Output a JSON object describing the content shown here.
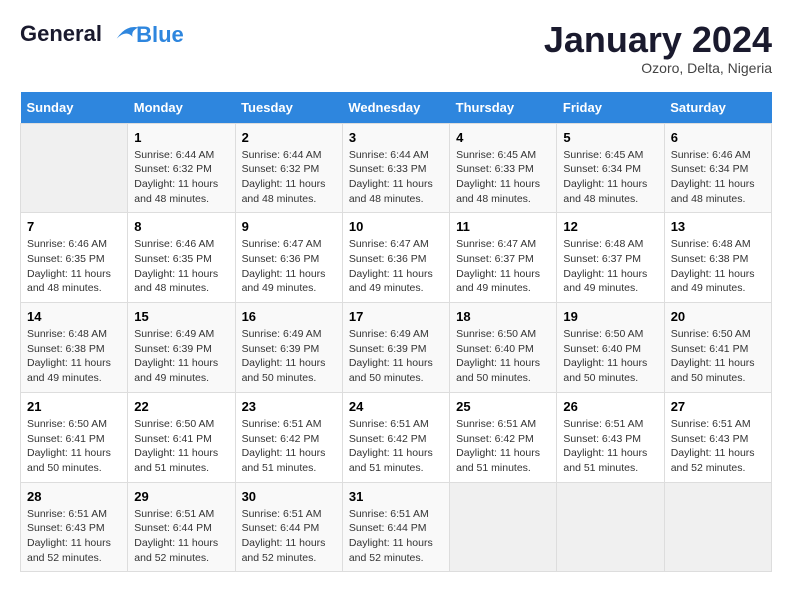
{
  "logo": {
    "line1": "General",
    "line2": "Blue"
  },
  "title": "January 2024",
  "location": "Ozoro, Delta, Nigeria",
  "days_of_week": [
    "Sunday",
    "Monday",
    "Tuesday",
    "Wednesday",
    "Thursday",
    "Friday",
    "Saturday"
  ],
  "weeks": [
    [
      {
        "day": "",
        "info": ""
      },
      {
        "day": "1",
        "info": "Sunrise: 6:44 AM\nSunset: 6:32 PM\nDaylight: 11 hours\nand 48 minutes."
      },
      {
        "day": "2",
        "info": "Sunrise: 6:44 AM\nSunset: 6:32 PM\nDaylight: 11 hours\nand 48 minutes."
      },
      {
        "day": "3",
        "info": "Sunrise: 6:44 AM\nSunset: 6:33 PM\nDaylight: 11 hours\nand 48 minutes."
      },
      {
        "day": "4",
        "info": "Sunrise: 6:45 AM\nSunset: 6:33 PM\nDaylight: 11 hours\nand 48 minutes."
      },
      {
        "day": "5",
        "info": "Sunrise: 6:45 AM\nSunset: 6:34 PM\nDaylight: 11 hours\nand 48 minutes."
      },
      {
        "day": "6",
        "info": "Sunrise: 6:46 AM\nSunset: 6:34 PM\nDaylight: 11 hours\nand 48 minutes."
      }
    ],
    [
      {
        "day": "7",
        "info": "Sunrise: 6:46 AM\nSunset: 6:35 PM\nDaylight: 11 hours\nand 48 minutes."
      },
      {
        "day": "8",
        "info": "Sunrise: 6:46 AM\nSunset: 6:35 PM\nDaylight: 11 hours\nand 48 minutes."
      },
      {
        "day": "9",
        "info": "Sunrise: 6:47 AM\nSunset: 6:36 PM\nDaylight: 11 hours\nand 49 minutes."
      },
      {
        "day": "10",
        "info": "Sunrise: 6:47 AM\nSunset: 6:36 PM\nDaylight: 11 hours\nand 49 minutes."
      },
      {
        "day": "11",
        "info": "Sunrise: 6:47 AM\nSunset: 6:37 PM\nDaylight: 11 hours\nand 49 minutes."
      },
      {
        "day": "12",
        "info": "Sunrise: 6:48 AM\nSunset: 6:37 PM\nDaylight: 11 hours\nand 49 minutes."
      },
      {
        "day": "13",
        "info": "Sunrise: 6:48 AM\nSunset: 6:38 PM\nDaylight: 11 hours\nand 49 minutes."
      }
    ],
    [
      {
        "day": "14",
        "info": "Sunrise: 6:48 AM\nSunset: 6:38 PM\nDaylight: 11 hours\nand 49 minutes."
      },
      {
        "day": "15",
        "info": "Sunrise: 6:49 AM\nSunset: 6:39 PM\nDaylight: 11 hours\nand 49 minutes."
      },
      {
        "day": "16",
        "info": "Sunrise: 6:49 AM\nSunset: 6:39 PM\nDaylight: 11 hours\nand 50 minutes."
      },
      {
        "day": "17",
        "info": "Sunrise: 6:49 AM\nSunset: 6:39 PM\nDaylight: 11 hours\nand 50 minutes."
      },
      {
        "day": "18",
        "info": "Sunrise: 6:50 AM\nSunset: 6:40 PM\nDaylight: 11 hours\nand 50 minutes."
      },
      {
        "day": "19",
        "info": "Sunrise: 6:50 AM\nSunset: 6:40 PM\nDaylight: 11 hours\nand 50 minutes."
      },
      {
        "day": "20",
        "info": "Sunrise: 6:50 AM\nSunset: 6:41 PM\nDaylight: 11 hours\nand 50 minutes."
      }
    ],
    [
      {
        "day": "21",
        "info": "Sunrise: 6:50 AM\nSunset: 6:41 PM\nDaylight: 11 hours\nand 50 minutes."
      },
      {
        "day": "22",
        "info": "Sunrise: 6:50 AM\nSunset: 6:41 PM\nDaylight: 11 hours\nand 51 minutes."
      },
      {
        "day": "23",
        "info": "Sunrise: 6:51 AM\nSunset: 6:42 PM\nDaylight: 11 hours\nand 51 minutes."
      },
      {
        "day": "24",
        "info": "Sunrise: 6:51 AM\nSunset: 6:42 PM\nDaylight: 11 hours\nand 51 minutes."
      },
      {
        "day": "25",
        "info": "Sunrise: 6:51 AM\nSunset: 6:42 PM\nDaylight: 11 hours\nand 51 minutes."
      },
      {
        "day": "26",
        "info": "Sunrise: 6:51 AM\nSunset: 6:43 PM\nDaylight: 11 hours\nand 51 minutes."
      },
      {
        "day": "27",
        "info": "Sunrise: 6:51 AM\nSunset: 6:43 PM\nDaylight: 11 hours\nand 52 minutes."
      }
    ],
    [
      {
        "day": "28",
        "info": "Sunrise: 6:51 AM\nSunset: 6:43 PM\nDaylight: 11 hours\nand 52 minutes."
      },
      {
        "day": "29",
        "info": "Sunrise: 6:51 AM\nSunset: 6:44 PM\nDaylight: 11 hours\nand 52 minutes."
      },
      {
        "day": "30",
        "info": "Sunrise: 6:51 AM\nSunset: 6:44 PM\nDaylight: 11 hours\nand 52 minutes."
      },
      {
        "day": "31",
        "info": "Sunrise: 6:51 AM\nSunset: 6:44 PM\nDaylight: 11 hours\nand 52 minutes."
      },
      {
        "day": "",
        "info": ""
      },
      {
        "day": "",
        "info": ""
      },
      {
        "day": "",
        "info": ""
      }
    ]
  ]
}
